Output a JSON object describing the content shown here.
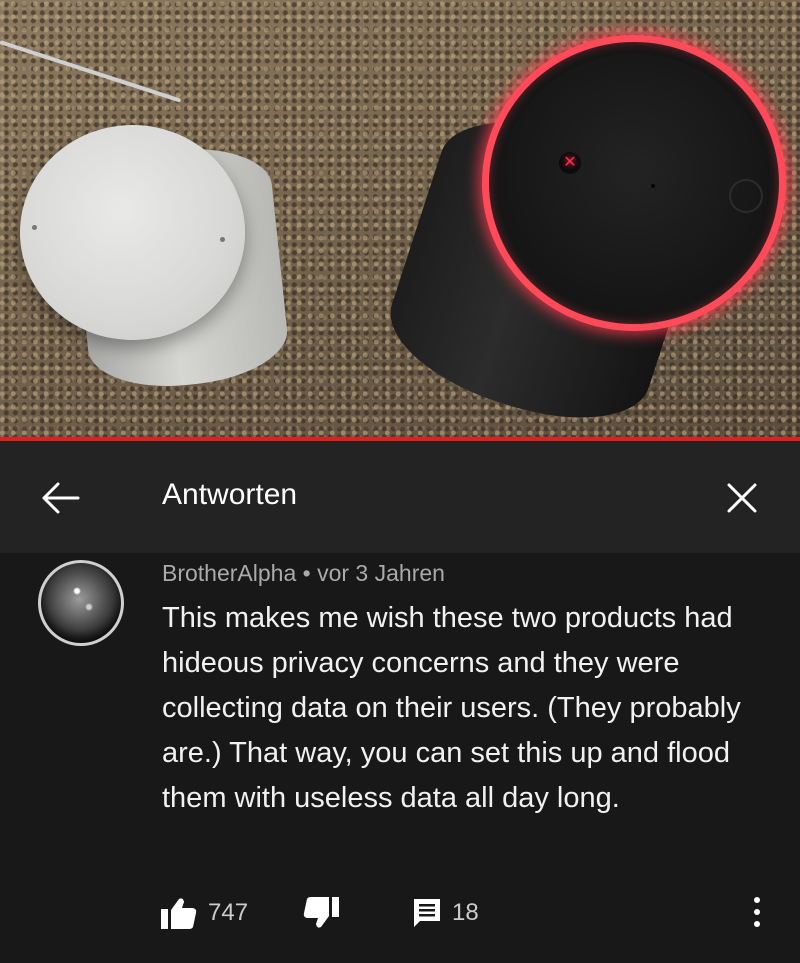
{
  "header": {
    "title": "Antworten"
  },
  "comment": {
    "author": "BrotherAlpha",
    "separator": "•",
    "time": "vor 3 Jahren",
    "text": "This makes me wish these two products had hideous privacy concerns and they were collecting data on their users. (They probably are.) That way, you can set this up and flood them with useless data all day long."
  },
  "actions": {
    "likes": "747",
    "replies": "18"
  },
  "icons": {
    "back": "arrow-left-icon",
    "close": "close-icon",
    "like": "thumbs-up-icon",
    "dislike": "thumbs-down-icon",
    "reply": "comment-icon",
    "more": "more-vertical-icon"
  },
  "colors": {
    "accent": "#e21e1e",
    "background": "#181818",
    "header_bg": "#232323"
  }
}
